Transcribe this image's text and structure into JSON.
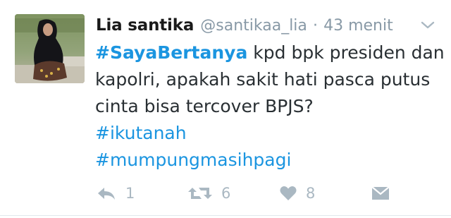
{
  "tweet": {
    "display_name": "Lia santika",
    "handle": "@santikaa_lia",
    "separator": "·",
    "timestamp": "43 menit",
    "body": {
      "hashtag_lead": "#SayaBertanya",
      "line1_rest": " kpd bpk presiden dan",
      "line2": "kapolri, apakah sakit hati pasca putus",
      "line3": "cinta bisa tercover BPJS?",
      "hashtag2": "#ikutanah",
      "hashtag3": "#mumpungmasihpagi"
    },
    "actions": {
      "reply_count": "1",
      "retweet_count": "6",
      "like_count": "8"
    }
  },
  "icons": {
    "caret": "chevron-down-icon",
    "reply": "reply-icon",
    "retweet": "retweet-icon",
    "like": "heart-icon",
    "dm": "envelope-icon"
  },
  "colors": {
    "hashtag": "#1b95e0",
    "meta": "#8899a6",
    "action": "#aab8c2",
    "text": "#292f33"
  }
}
